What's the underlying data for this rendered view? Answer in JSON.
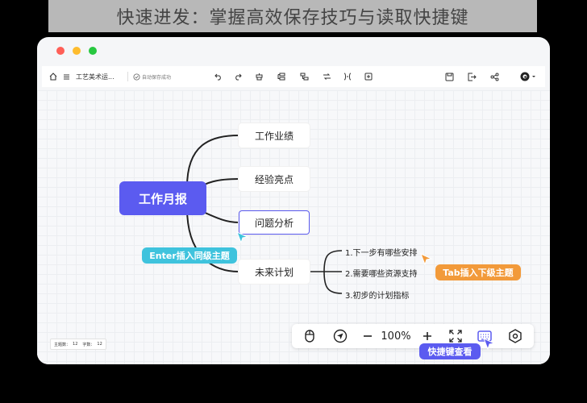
{
  "banner": {
    "title": "快速进发：掌握高效保存技巧与读取快捷键"
  },
  "window_controls": {
    "close_color": "#ff5f57",
    "minimize_color": "#febc2e",
    "maximize_color": "#28c840"
  },
  "toolbar": {
    "doc_title": "工艺美术运...",
    "save_status": "自动保存成功",
    "icons": [
      "home-icon",
      "menu-icon",
      "undo-icon",
      "redo-icon",
      "insert-topic-icon",
      "insert-subtopic-icon",
      "relation-icon",
      "summary-icon",
      "boundary-icon",
      "add-icon",
      "save-icon",
      "export-icon",
      "share-icon",
      "avatar"
    ]
  },
  "mindmap": {
    "root": "工作月报",
    "branches": [
      {
        "label": "工作业绩"
      },
      {
        "label": "经验亮点"
      },
      {
        "label": "问题分析"
      },
      {
        "label": "未来计划",
        "children": [
          "1.下一步有哪些安排",
          "2.需要哪些资源支持",
          "3.初步的计划指标"
        ]
      }
    ]
  },
  "hints": {
    "enter": "Enter插入同级主题",
    "tab": "Tab插入下级主题",
    "shortcut": "快捷键查看"
  },
  "zoom": {
    "level": "100%"
  },
  "stats": {
    "topics_label": "主题数：",
    "topics": "12",
    "words_label": "字数：",
    "words": "12"
  },
  "colors": {
    "accent": "#5b5bf0",
    "enter_hint": "#3fc3dd",
    "tab_hint": "#f29a3a",
    "shortcut_hint": "#5b5bf0"
  }
}
